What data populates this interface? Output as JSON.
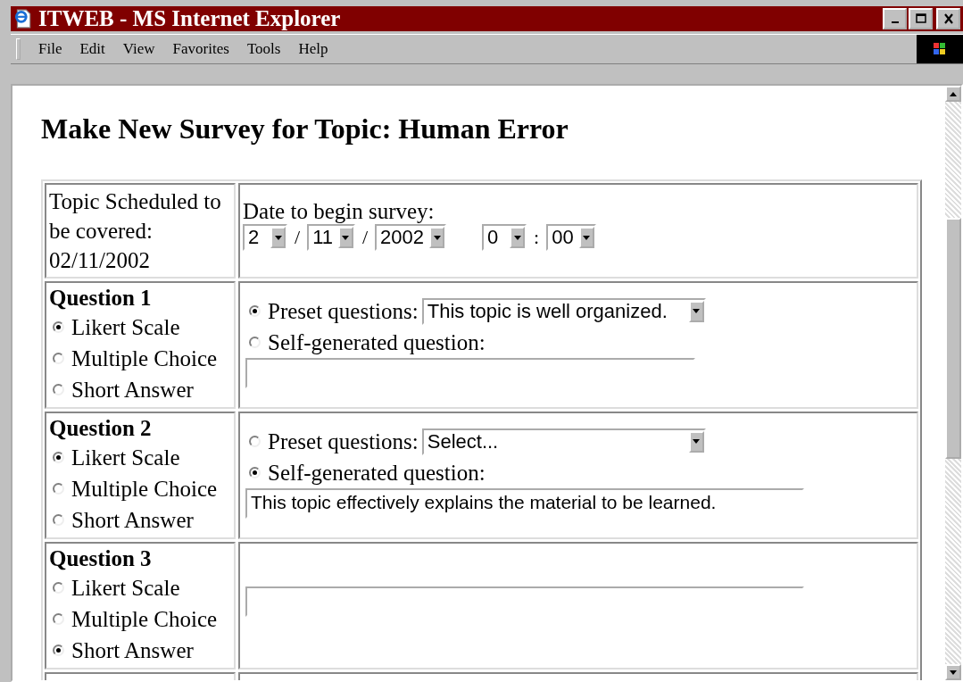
{
  "window": {
    "title": "ITWEB - MS Internet Explorer"
  },
  "menu": [
    "File",
    "Edit",
    "View",
    "Favorites",
    "Tools",
    "Help"
  ],
  "heading": "Make New Survey for Topic: Human Error",
  "schedule": {
    "text": "Topic Scheduled to be covered: 02/11/2002",
    "date_label": "Date to begin survey:",
    "date_parts": [
      {
        "kind": "select",
        "value": "2"
      },
      {
        "kind": "sep",
        "text": "/"
      },
      {
        "kind": "select",
        "value": "11"
      },
      {
        "kind": "sep",
        "text": "/"
      },
      {
        "kind": "select",
        "value": "2002"
      },
      {
        "kind": "gap"
      },
      {
        "kind": "select",
        "value": "0"
      },
      {
        "kind": "sep",
        "text": ":"
      },
      {
        "kind": "select",
        "value": "00"
      }
    ]
  },
  "questions": [
    {
      "title": "Question 1",
      "types": [
        {
          "label": "Likert Scale",
          "selected": true
        },
        {
          "label": "Multiple Choice",
          "selected": false
        },
        {
          "label": "Short Answer",
          "selected": false
        }
      ],
      "preset": {
        "label": "Preset questions:",
        "selected": true,
        "value": "This topic is well organized."
      },
      "self": {
        "label": "Self-generated question:",
        "selected": false
      },
      "answer_field": {
        "wide": false
      }
    },
    {
      "title": "Question 2",
      "types": [
        {
          "label": "Likert Scale",
          "selected": true
        },
        {
          "label": "Multiple Choice",
          "selected": false
        },
        {
          "label": "Short Answer",
          "selected": false
        }
      ],
      "preset": {
        "label": "Preset questions:",
        "selected": false,
        "value": "Select..."
      },
      "self": {
        "label": "Self-generated question:",
        "selected": true
      },
      "answer_field": {
        "wide": true,
        "value": "This topic effectively explains the material to be learned."
      }
    },
    {
      "title": "Question 3",
      "types": [
        {
          "label": "Likert Scale",
          "selected": false
        },
        {
          "label": "Multiple Choice",
          "selected": false
        },
        {
          "label": "Short Answer",
          "selected": true
        }
      ],
      "answer_field": {
        "wide": true
      }
    }
  ]
}
